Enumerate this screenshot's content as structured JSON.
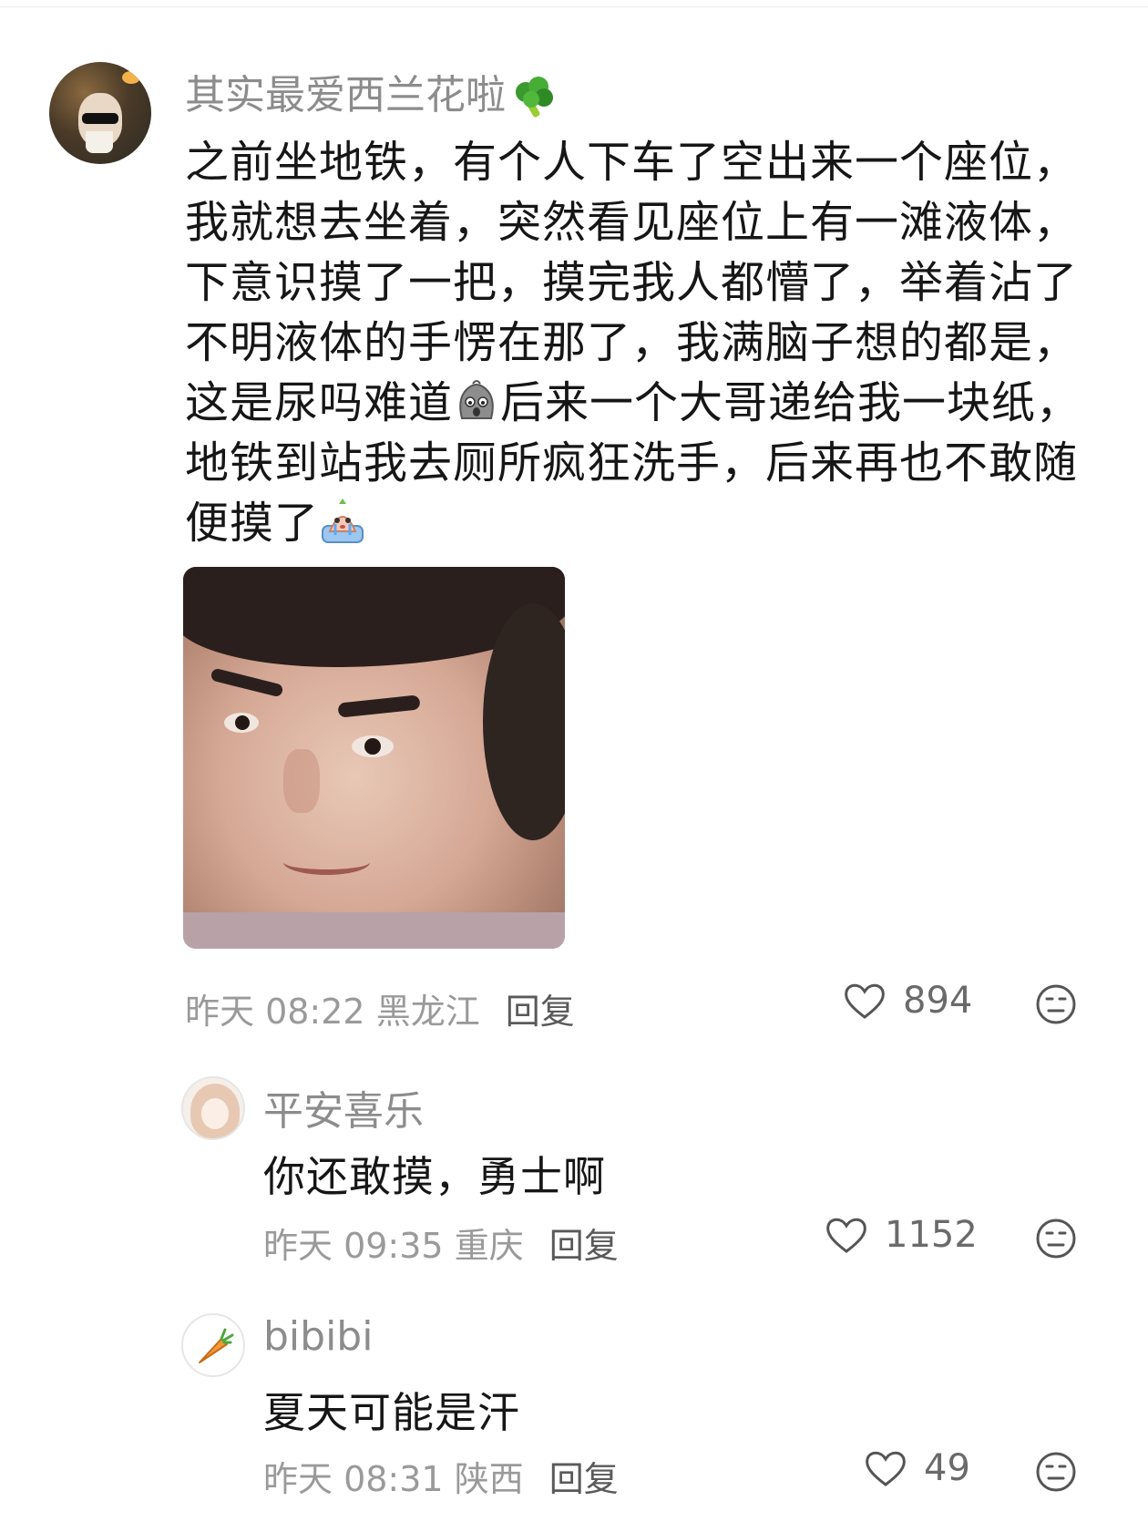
{
  "main_comment": {
    "username": "其实最爱西兰花啦",
    "username_emoji": "broccoli-emoji",
    "body_lines": [
      "之前坐地铁，有个人下车了空出来一个座位，",
      "我就想去坐着，突然看见座位上有一滩液体，",
      "下意识摸了一把，摸完我人都懵了，举着沾了",
      "不明液体的手愣在那了，我满脑子想的都是，",
      "这是尿吗难道",
      "后来一个大哥递给我一块纸，",
      "地铁到站我去厕所疯狂洗手，后来再也不敢随",
      "便摸了"
    ],
    "inline_emojis": [
      "shocked-face-emoji",
      "crying-face-emoji"
    ],
    "time": "昨天 08:22",
    "location": "黑龙江",
    "reply_label": "回复",
    "likes": "894"
  },
  "replies": [
    {
      "username": "平安喜乐",
      "text": "你还敢摸，勇士啊",
      "time": "昨天 09:35",
      "location": "重庆",
      "reply_label": "回复",
      "likes": "1152"
    },
    {
      "username": "bibibi",
      "text": "夏天可能是汗",
      "time": "昨天 08:31",
      "location": "陕西",
      "reply_label": "回复",
      "likes": "49"
    }
  ],
  "icons": {
    "like": "heart-outline-icon",
    "dislike": "meh-face-icon"
  },
  "colors": {
    "username": "#8c8c8c",
    "text": "#161616",
    "meta": "#9a9a9a"
  }
}
